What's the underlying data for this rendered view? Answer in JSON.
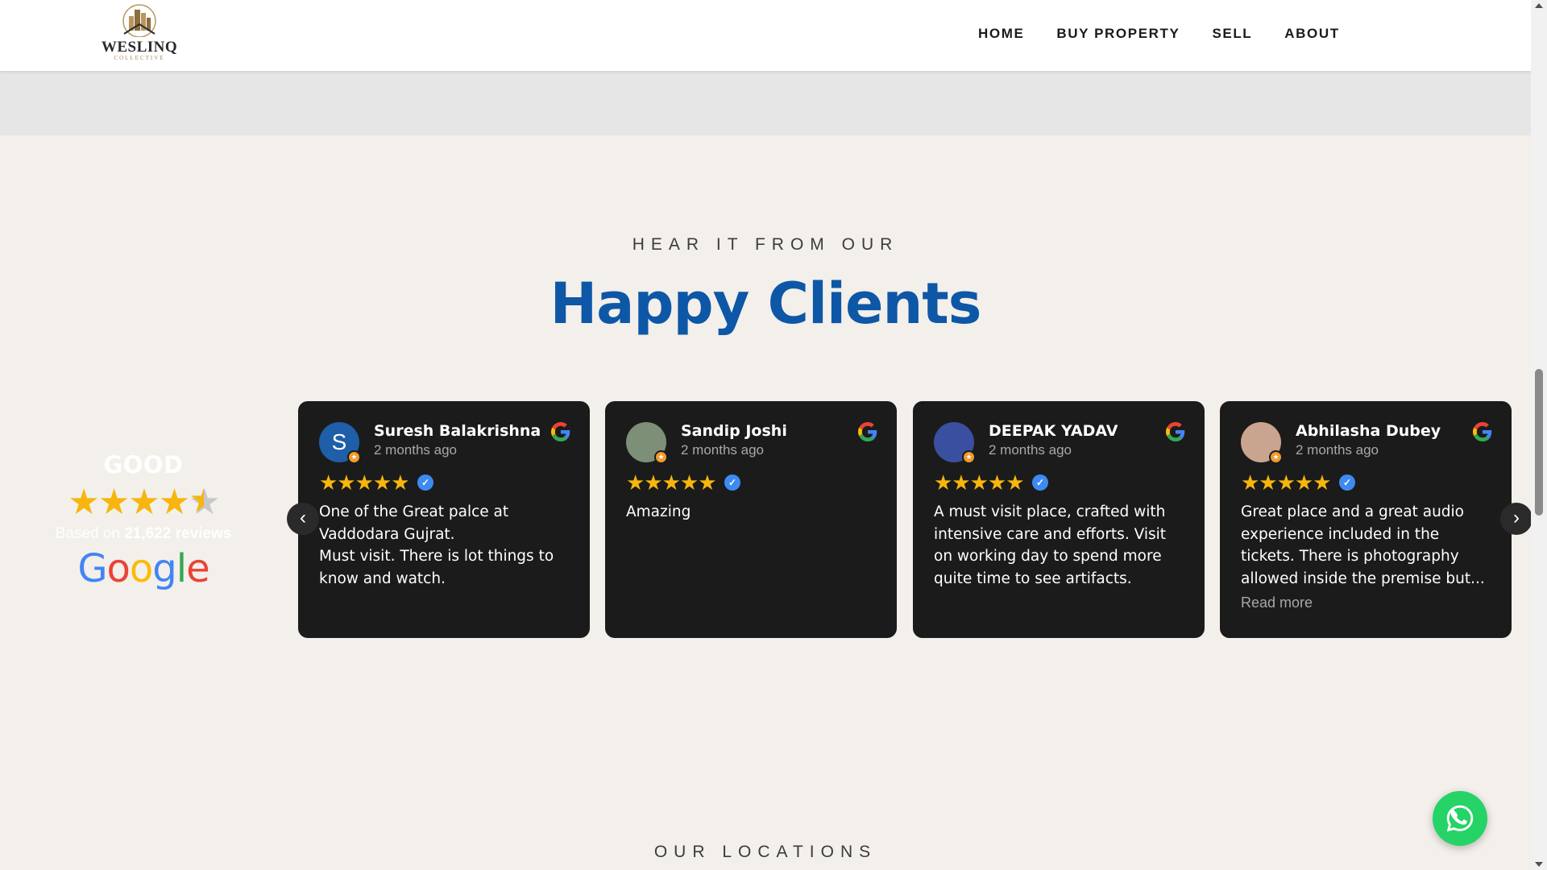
{
  "header": {
    "logo_name": "WESLINQ",
    "logo_sub": "COLLECTIVE",
    "nav": [
      "HOME",
      "BUY PROPERTY",
      "SELL",
      "ABOUT"
    ]
  },
  "section": {
    "eyebrow": "HEAR IT FROM OUR",
    "title": "Happy Clients"
  },
  "summary": {
    "label": "GOOD",
    "rating_stars": 4.5,
    "reviews_prefix": "Based on",
    "reviews_count": "21,622 reviews",
    "google_logo": "Google"
  },
  "reviews": [
    {
      "name": "Suresh Balakrishna",
      "time": "2 months ago",
      "avatar_letter": "S",
      "avatar_color": "#1f5ea8",
      "stars": 5,
      "text": "One of the Great palce at Vaddodara Gujrat.\nMust visit. There is lot things to know and watch."
    },
    {
      "name": "Sandip Joshi",
      "time": "2 months ago",
      "avatar_letter": "",
      "avatar_color": "#7d8f77",
      "stars": 5,
      "text": "Amazing"
    },
    {
      "name": "DEEPAK YADAV",
      "time": "2 months ago",
      "avatar_letter": "",
      "avatar_color": "#3b4fa0",
      "stars": 5,
      "text": "A must visit place, crafted with intensive care and efforts. Visit on working day to spend more quite time to see artifacts."
    },
    {
      "name": "Abhilasha Dubey",
      "time": "2 months ago",
      "avatar_letter": "",
      "avatar_color": "#c9a48f",
      "stars": 5,
      "text": "Great place and a great audio experience included in the tickets. There is photography allowed inside the premise but...",
      "read_more": "Read more"
    }
  ],
  "carousel": {
    "prev_icon": "chevron-left-icon",
    "next_icon": "chevron-right-icon"
  },
  "locations": {
    "eyebrow": "OUR LOCATIONS"
  },
  "colors": {
    "accent_blue": "#0d57a6",
    "star_gold": "#f6b60e",
    "card_bg": "#1b1b1b",
    "page_bg": "#f3efeb",
    "whatsapp_green": "#25d366"
  }
}
